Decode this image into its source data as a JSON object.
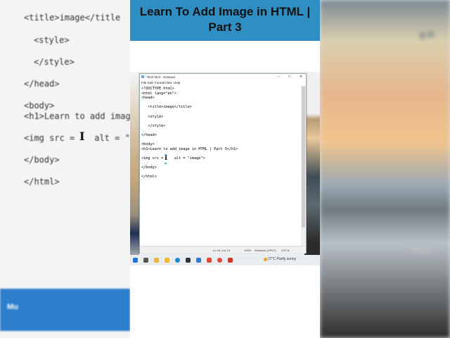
{
  "background": {
    "code_lines": [
      "<title>image</title",
      "<style>",
      "</style>",
      "</head>",
      "<body>",
      "<h1>Learn to add imag",
      "<img src = ",
      " alt = \"",
      "</body>",
      "</html>"
    ],
    "right_text_1": "g in",
    "right_text_2": "Music",
    "left_bar_text": "Mu"
  },
  "banner": {
    "title_line1": "Learn To Add Image in HTML |",
    "title_line2": "Part 3"
  },
  "notepad": {
    "window_title": "*html.html - Notepad",
    "controls": [
      "–",
      "□",
      "✕"
    ],
    "menu": [
      "File",
      "Edit",
      "Format",
      "View",
      "Help"
    ],
    "code_lines": [
      "<!DOCTYPE html>",
      "<html lang=\"en\">",
      "<head>",
      "",
      "   <title>image</title>",
      "",
      "   <style>",
      "",
      "   </style>",
      "",
      "</head>",
      "",
      "<body>",
      "<h1>Learn to add image in HTML | Part 3</h1>",
      "",
      "<img src =     alt = \"image\">",
      "",
      "</body>",
      "",
      "</html>"
    ],
    "status": {
      "position": "Ln 16, Col 13",
      "zoom": "100%",
      "line_ending": "Windows (CRLF)",
      "encoding": "UTF-8"
    }
  },
  "taskbar": {
    "weather": "27°C  Partly sunny",
    "icons": [
      "start-icon",
      "search-icon",
      "explorer-icon",
      "files-icon",
      "edge-icon",
      "store-icon",
      "vscode-icon",
      "photos-icon",
      "chrome-icon",
      "media-icon"
    ]
  },
  "colors": {
    "banner": "#2f8fc2",
    "cursor_accent": "#3aa6c9"
  }
}
